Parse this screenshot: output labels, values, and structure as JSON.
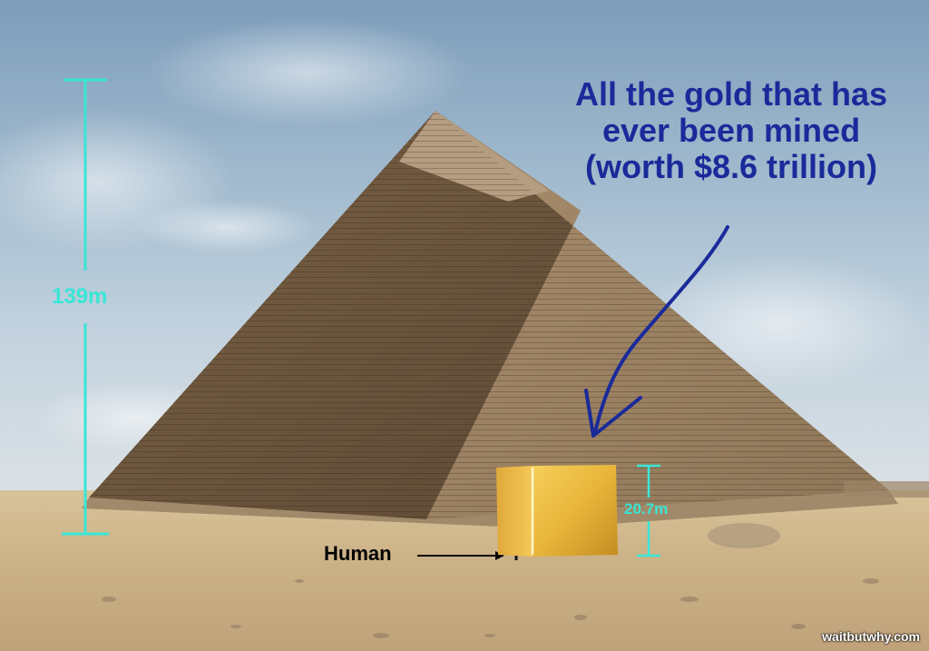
{
  "headline": {
    "line1": "All the gold that has",
    "line2": "ever been mined",
    "line3": "(worth $8.6 trillion)"
  },
  "pyramid_height_label": "139m",
  "cube_height_label": "20.7m",
  "human_label": "Human",
  "credit": "waitbutwhy.com",
  "colors": {
    "headline": "#1a2a9a",
    "measure": "#39e6d6",
    "arrow": "#1a2a9a",
    "gold": "#e8b53a"
  }
}
